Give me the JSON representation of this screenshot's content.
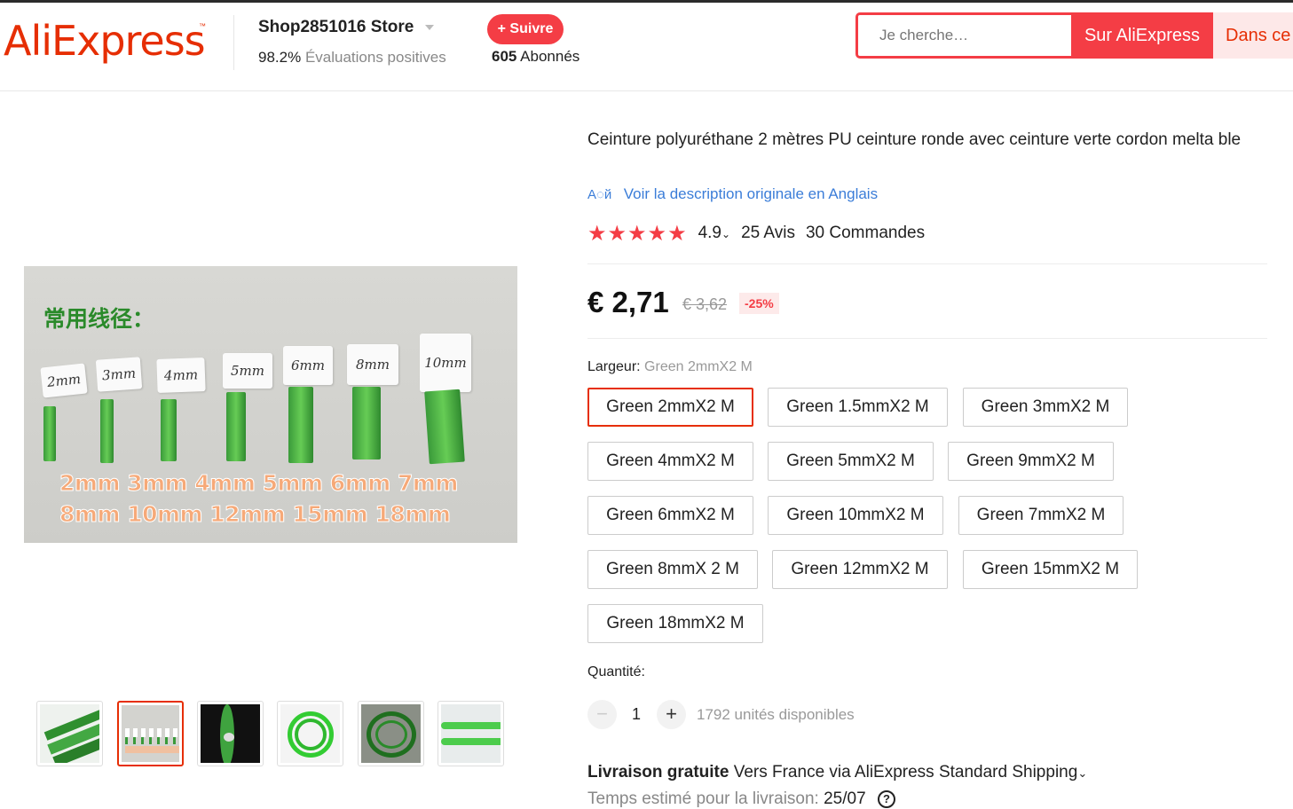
{
  "header": {
    "logo_text": "AliExpress",
    "logo_tm": "™",
    "store_name": "Shop2851016 Store",
    "store_rating_value": "98.2%",
    "store_rating_label": "Évaluations positives",
    "follow_label": "+ Suivre",
    "followers_count": "605",
    "followers_label": "Abonnés",
    "search_placeholder": "Je cherche…",
    "search_aliexpress_label": "Sur AliExpress",
    "search_store_label": "Dans ce"
  },
  "gallery": {
    "main_image": {
      "title_text": "常用线径：",
      "tags": [
        "2mm",
        "3mm",
        "4mm",
        "5mm",
        "6mm",
        "8mm",
        "10mm"
      ],
      "caption_line1": "2mm 3mm 4mm 5mm 6mm 7mm",
      "caption_line2": "8mm 10mm 12mm 15mm 18mm"
    },
    "thumbnails_count": 6,
    "active_thumbnail": 2
  },
  "product": {
    "title": "Ceinture polyuréthane 2 mètres PU ceinture ronde avec ceinture verte cordon melta ble",
    "translate_icon": "translate-icon",
    "translate_label": "Voir la description originale en Anglais",
    "stars": "★★★★★",
    "rating": "4.9",
    "rating_caret": "⌄",
    "reviews": "25 Avis",
    "orders": "30 Commandes",
    "price": "€ 2,71",
    "old_price": "€ 3,62",
    "discount": "-25%",
    "property_label": "Largeur:",
    "property_selected": "Green 2mmX2 M",
    "options": [
      "Green 2mmX2 M",
      "Green 1.5mmX2 M",
      "Green 3mmX2 M",
      "Green 4mmX2 M",
      "Green 5mmX2 M",
      "Green 9mmX2 M",
      "Green 6mmX2 M",
      "Green 10mmX2 M",
      "Green 7mmX2 M",
      "Green 8mmX 2 M",
      "Green 12mmX2 M",
      "Green 15mmX2 M",
      "Green 18mmX2 M"
    ],
    "quantity_label": "Quantité:",
    "quantity_minus": "−",
    "quantity_plus": "+",
    "quantity_value": "1",
    "stock": "1792 unités disponibles",
    "shipping_bold": "Livraison gratuite",
    "shipping_rest": " Vers France via AliExpress Standard Shipping",
    "shipping_caret": "⌄",
    "delivery_label": "Temps estimé pour la livraison:",
    "delivery_date": "25/07",
    "help_icon": "?"
  },
  "colors": {
    "brand": "#e62e04",
    "accent_red": "#f43d45",
    "link_blue": "#3b7dd8",
    "product_green": "#3a9a3a"
  }
}
